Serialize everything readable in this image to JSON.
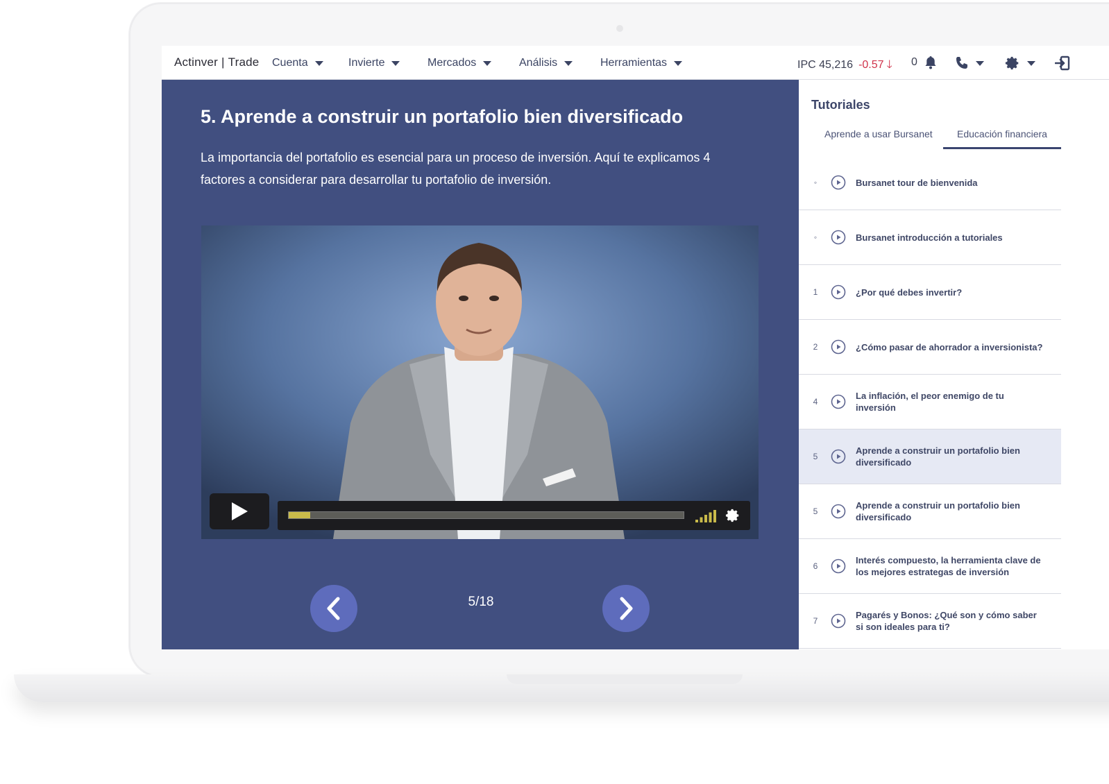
{
  "nav": {
    "brand_left": "Actinver",
    "brand_right": "Trade",
    "menus": [
      {
        "label": "Cuenta"
      },
      {
        "label": "Invierte"
      },
      {
        "label": "Mercados"
      },
      {
        "label": "Análisis"
      },
      {
        "label": "Herramientas"
      }
    ],
    "ipc_label": "IPC 45,216",
    "ipc_change": "-0.57",
    "notifications_count": "0"
  },
  "lesson": {
    "title": "5. Aprende a construir un portafolio bien diversificado",
    "description": "La importancia del portafolio es esencial para un proceso de inversión. Aquí te explicamos 4 factores a considerar para desarrollar tu portafolio de inversión.",
    "video": {
      "progress": 0.055,
      "volume_level": 5
    },
    "counter": "5/18"
  },
  "sidebar": {
    "title": "Tutoriales",
    "tabs": [
      {
        "label": "Aprende a usar Bursanet",
        "active": false
      },
      {
        "label": "Educación financiera",
        "active": true
      }
    ],
    "items": [
      {
        "num": "◦",
        "label": "Bursanet tour de bienvenida"
      },
      {
        "num": "◦",
        "label": "Bursanet introducción a tutoriales"
      },
      {
        "num": "1",
        "label": "¿Por qué debes invertir?"
      },
      {
        "num": "2",
        "label": "¿Cómo pasar de ahorrador a inversionista?"
      },
      {
        "num": "4",
        "label": "La inflación, el peor enemigo de tu inversión"
      },
      {
        "num": "5",
        "label": "Aprende a construir un portafolio bien diversificado",
        "active": true
      },
      {
        "num": "5",
        "label": "Aprende a construir un portafolio bien diversificado"
      },
      {
        "num": "6",
        "label": "Interés compuesto, la herramienta clave de los mejores estrategas de inversión"
      },
      {
        "num": "7",
        "label": "Pagarés y Bonos: ¿Qué son y cómo saber si son ideales para ti?"
      }
    ]
  },
  "colors": {
    "lesson_bg": "#414f80",
    "accent_button": "#5e6cbc",
    "negative": "#d0324a",
    "progress_fill": "#c9ba4a"
  }
}
